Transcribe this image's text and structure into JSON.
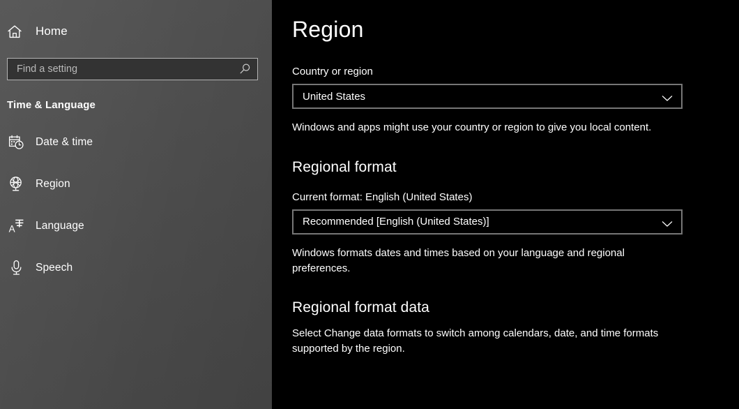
{
  "sidebar": {
    "home": {
      "label": "Home",
      "icon": "home-icon"
    },
    "search": {
      "placeholder": "Find a setting",
      "value": "",
      "icon": "search-icon"
    },
    "section_title": "Time & Language",
    "items": [
      {
        "label": "Date & time",
        "icon": "calendar-clock-icon",
        "selected": false
      },
      {
        "label": "Region",
        "icon": "globe-icon",
        "selected": true
      },
      {
        "label": "Language",
        "icon": "translate-icon",
        "selected": false
      },
      {
        "label": "Speech",
        "icon": "microphone-icon",
        "selected": false
      }
    ]
  },
  "content": {
    "page_title": "Region",
    "country_label": "Country or region",
    "country_value": "United States",
    "country_description": "Windows and apps might use your country or region to give you local content.",
    "regional_format_heading": "Regional format",
    "current_format_label": "Current format: English (United States)",
    "regional_format_value": "Recommended [English (United States)]",
    "regional_format_description": "Windows formats dates and times based on your language and regional preferences.",
    "regional_format_data_heading": "Regional format data",
    "regional_format_data_description": "Select Change data formats to switch among calendars, date, and time formats supported by the region."
  },
  "colors": {
    "sidebar_top": "#525252",
    "sidebar_bottom": "#454545",
    "content_bg": "#000000",
    "text": "#ffffff",
    "placeholder": "#b9b9b9",
    "combo_border": "#767676",
    "search_border": "#b4b4b4",
    "search_fill": "#333333"
  }
}
